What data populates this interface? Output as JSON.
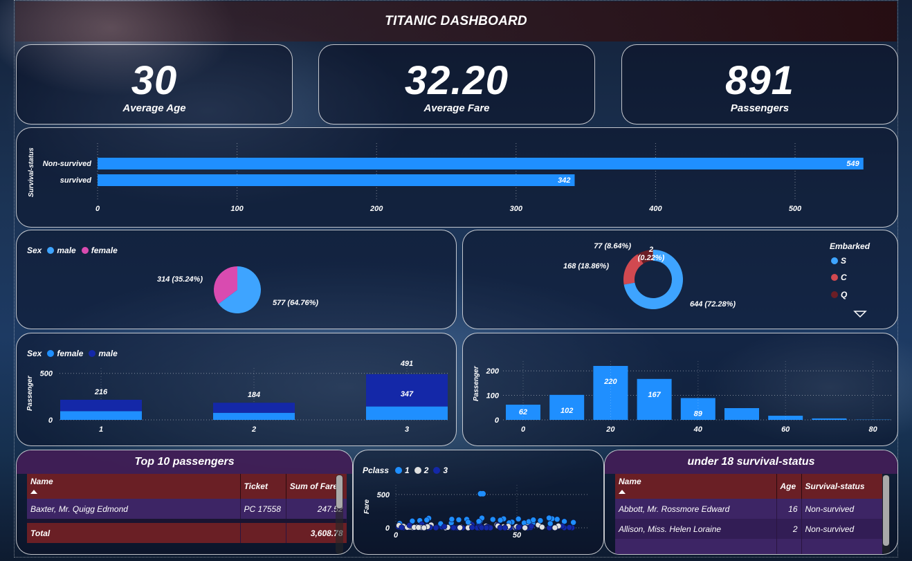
{
  "dashboard": {
    "title": "TITANIC DASHBOARD"
  },
  "kpis": [
    {
      "value": "30",
      "label": "Average Age"
    },
    {
      "value": "32.20",
      "label": "Average Fare"
    },
    {
      "value": "891",
      "label": "Passengers"
    }
  ],
  "chart_data": [
    {
      "type": "bar",
      "orientation": "horizontal",
      "categories": [
        "Non-survived",
        "survived"
      ],
      "values": [
        549,
        342
      ],
      "ylabel": "Survival-status",
      "xlim": [
        0,
        550
      ],
      "xticks": [
        0,
        100,
        200,
        300,
        400,
        500
      ],
      "color": "#1f8fff"
    },
    {
      "type": "pie",
      "legend_title": "Sex",
      "labels": [
        "male",
        "female"
      ],
      "values": [
        577,
        314
      ],
      "data_labels": [
        "577 (64.76%)",
        "314 (35.24%)"
      ],
      "colors": [
        "#3ea4ff",
        "#d94bb0"
      ]
    },
    {
      "type": "pie",
      "donut": true,
      "legend_title": "Embarked",
      "labels": [
        "S",
        "C",
        "Q"
      ],
      "values": [
        644,
        168,
        77,
        2
      ],
      "data_labels": [
        "644 (72.28%)",
        "168 (18.86%)",
        "77 (8.64%)",
        "2 (0.22%)"
      ],
      "colors": [
        "#3ea4ff",
        "#d14950",
        "#6b1e26",
        "#888888"
      ]
    },
    {
      "type": "bar",
      "stacked": true,
      "legend_title": "Sex",
      "categories": [
        "1",
        "2",
        "3"
      ],
      "series": [
        {
          "name": "female",
          "values": [
            94,
            76,
            144
          ],
          "color": "#1f8fff"
        },
        {
          "name": "male",
          "values": [
            122,
            108,
            347
          ],
          "color": "#1428a8"
        }
      ],
      "totals": [
        216,
        184,
        491
      ],
      "data_labels": [
        "216",
        "184",
        "347",
        "491"
      ],
      "ylabel": "Passenger",
      "ylim": [
        0,
        520
      ],
      "yticks": [
        0,
        500
      ]
    },
    {
      "type": "bar",
      "categories": [
        0,
        10,
        20,
        30,
        40,
        50,
        60,
        70,
        80
      ],
      "values": [
        62,
        102,
        220,
        167,
        89,
        48,
        17,
        6,
        1
      ],
      "data_labels": [
        "62",
        "102",
        "220",
        "167",
        "89"
      ],
      "ylabel": "Passenger",
      "ylim": [
        0,
        220
      ],
      "yticks": [
        0,
        100,
        200
      ],
      "xticks": [
        0,
        20,
        40,
        60,
        80
      ],
      "color": "#1f8fff"
    },
    {
      "type": "scatter",
      "legend_title": "Pclass",
      "series_names": [
        "1",
        "2",
        "3"
      ],
      "colors": [
        "#1f8fff",
        "#e0e0e0",
        "#1428a8"
      ],
      "ylabel": "Fare",
      "yticks": [
        0,
        500
      ],
      "xticks": [
        0,
        50
      ],
      "xlim": [
        0,
        80
      ],
      "ylim": [
        0,
        520
      ]
    }
  ],
  "top10": {
    "title": "Top 10 passengers",
    "columns": [
      "Name",
      "Ticket",
      "Sum of Fare"
    ],
    "rows": [
      [
        "Baxter, Mr. Quigg Edmond",
        "PC 17558",
        "247.52"
      ]
    ],
    "total_label": "Total",
    "total_value": "3,608.78"
  },
  "under18": {
    "title": "under 18 survival-status",
    "columns": [
      "Name",
      "Age",
      "Survival-status"
    ],
    "rows": [
      [
        "Abbott, Mr. Rossmore Edward",
        "16",
        "Non-survived"
      ],
      [
        "Allison, Miss. Helen Loraine",
        "2",
        "Non-survived"
      ]
    ]
  }
}
